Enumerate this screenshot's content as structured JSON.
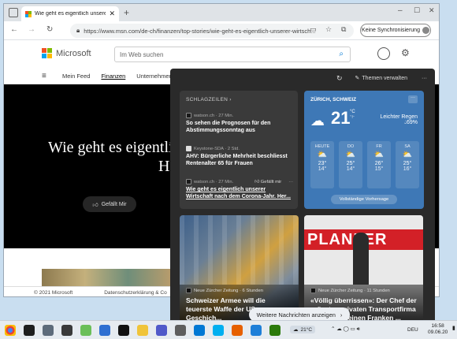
{
  "browser": {
    "tab_title": "Wie geht es eigentlich unserer K",
    "url": "https://www.msn.com/de-ch/finanzen/top-stories/wie-geht-es-eigentlich-unserer-wirtsch...",
    "sync_label": "Keine Synchronisierung"
  },
  "msn": {
    "brand": "Microsoft",
    "search_placeholder": "Im Web suchen",
    "nav": [
      "Mein Feed",
      "Finanzen",
      "Unternehmen"
    ],
    "hero_title_line1": "Wie geht es eigentlich u",
    "hero_title_line2": "H",
    "hero_like": "Gefällt Mir",
    "footer_copyright": "© 2021 Microsoft",
    "footer_privacy": "Datenschutzerklärung & Co"
  },
  "widgets": {
    "manage_label": "Themen verwalten",
    "headlines": {
      "label": "SCHLAGZEILEN",
      "items": [
        {
          "source": "watson.ch · 27 Min.",
          "title": "So sehen die Prognosen für den Abstimmungssonntag aus",
          "logo_color": "#1a1a1a"
        },
        {
          "source": "Keystone-SDA · 2 Std.",
          "title": "AHV: Bürgerliche Mehrheit beschliesst Rentenalter 65 für Frauen",
          "logo_color": "#e0e0e0"
        },
        {
          "source": "watson.ch · 27 Min.",
          "title": "Wie geht es eigentlich unserer Wirtschaft nach dem Corona-Jahr. Her...",
          "like": "Gefällt mir",
          "logo_color": "#1a1a1a"
        }
      ]
    },
    "weather": {
      "location": "ZÜRICH, SCHWEIZ",
      "temp": "21",
      "unit_c": "°C",
      "unit_f": "°F",
      "condition": "Leichter Regen",
      "humidity": "69%",
      "days": [
        {
          "name": "HEUTE",
          "hi": "23°",
          "lo": "14°"
        },
        {
          "name": "DO",
          "hi": "25°",
          "lo": "14°"
        },
        {
          "name": "FR",
          "hi": "26°",
          "lo": "15°"
        },
        {
          "name": "SA",
          "hi": "25°",
          "lo": "16°"
        }
      ],
      "forecast_link": "Vollständige Vorhersage"
    },
    "cards": [
      {
        "source": "Neue Zürcher Zeitung · 6 Stunden",
        "title": "Schweizer Armee will die teuerste Waffe der US-Geschich..."
      },
      {
        "source": "Neue Zürcher Zeitung · 11 Stunden",
        "title": "«Völlig überrissen»: Der Chef der grössten privaten Transportfirma in ... dürfe keinen Franken ...",
        "photo_text": "PLANZER"
      }
    ],
    "more_news": "Weitere Nachrichten anzeigen"
  },
  "taskbar": {
    "temperature": "21°C",
    "lang": "DEU",
    "time": "16:58",
    "date": "09.06.20"
  }
}
